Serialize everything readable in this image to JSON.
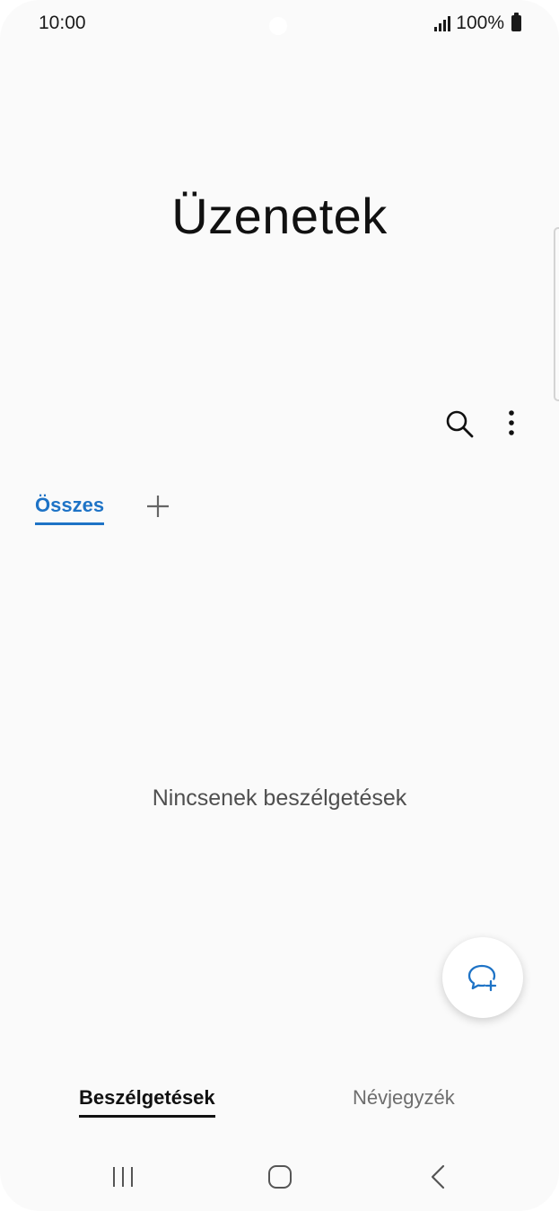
{
  "status_bar": {
    "time": "10:00",
    "battery": "100%",
    "icons": [
      "signal-icon",
      "battery-icon"
    ]
  },
  "header": {
    "title": "Üzenetek",
    "actions": [
      "search-icon",
      "more-options-icon"
    ]
  },
  "tabs": {
    "active_label": "Összes",
    "add_icon": "plus-icon",
    "accent_color": "#1e73c6"
  },
  "main": {
    "empty_message": "Nincsenek beszélgetések"
  },
  "fab": {
    "icon": "new-chat-icon",
    "icon_color": "#1e73c6"
  },
  "bottom_tabs": {
    "conversations_label": "Beszélgetések",
    "contacts_label": "Névjegyzék"
  },
  "nav_bar": {
    "icons": [
      "recent-apps-icon",
      "home-icon",
      "back-icon"
    ]
  }
}
